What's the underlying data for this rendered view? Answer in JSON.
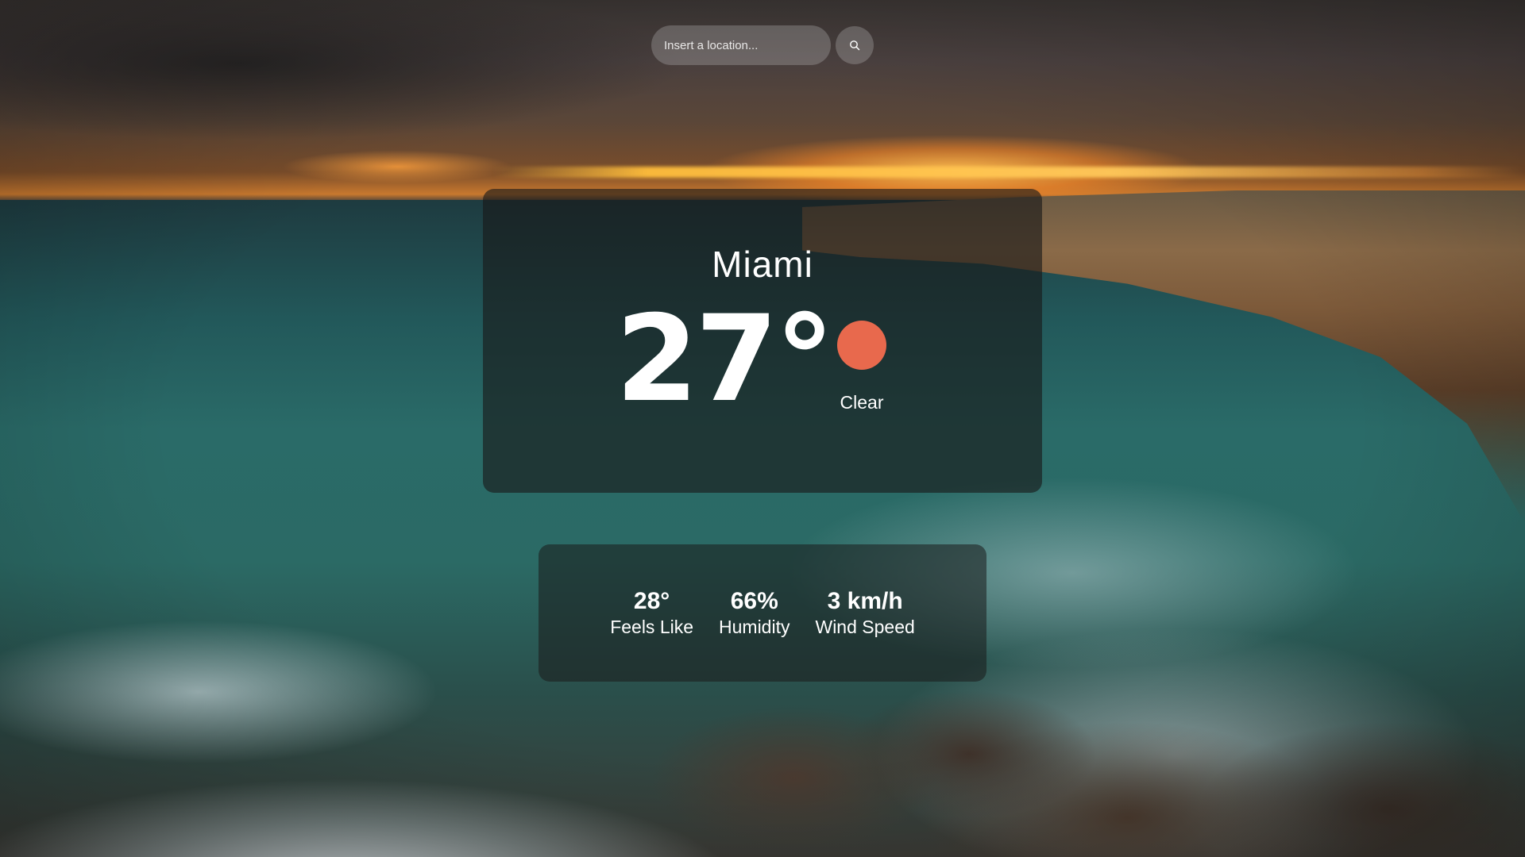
{
  "search": {
    "placeholder": "Insert a location...",
    "value": "",
    "button_icon": "search-icon"
  },
  "weather": {
    "city": "Miami",
    "temperature": "27°",
    "condition": "Clear",
    "condition_icon": "sun-icon",
    "condition_icon_color": "#e8694d"
  },
  "stats": {
    "feels_like": {
      "value": "28°",
      "label": "Feels Like"
    },
    "humidity": {
      "value": "66%",
      "label": "Humidity"
    },
    "wind_speed": {
      "value": "3 km/h",
      "label": "Wind Speed"
    }
  },
  "background": {
    "description_icon": "seascape-background-image"
  }
}
